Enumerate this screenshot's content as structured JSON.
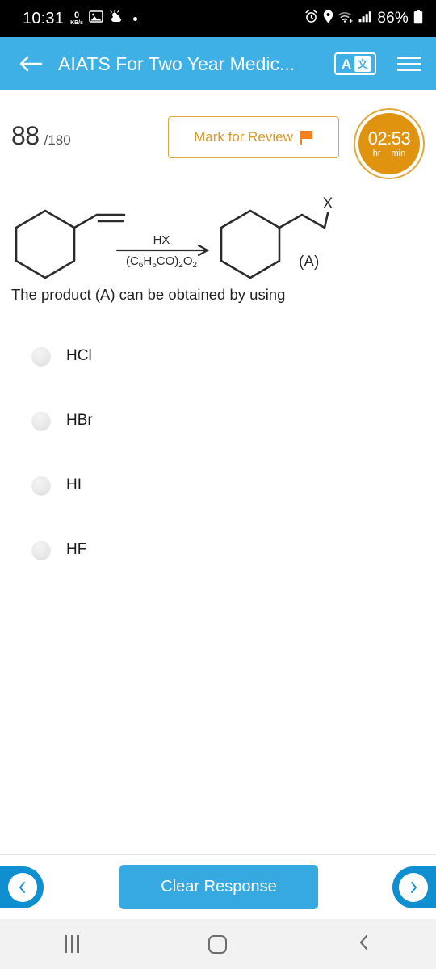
{
  "status_bar": {
    "time": "10:31",
    "data_rate_value": "0",
    "data_rate_unit": "KB/s",
    "icons": [
      "image-icon",
      "weather-icon",
      "dot-icon",
      "alarm-icon",
      "location-icon",
      "wifi-icon",
      "signal-icon",
      "battery-icon"
    ],
    "battery_percent": "86%"
  },
  "app_bar": {
    "back_label": "back-arrow",
    "title": "AIATS For Two Year Medic...",
    "translate_letter": "A",
    "translate_glyph": "文",
    "menu_label": "menu",
    "background_color": "#3fb0e5"
  },
  "question_header": {
    "current_number": "88",
    "total_label": "/180",
    "mark_for_review_label": "Mark for Review",
    "mark_for_review_color": "#d79a2b",
    "timer_value": "02:53",
    "timer_unit_hours": "hr",
    "timer_unit_minutes": "min",
    "timer_color": "#e0930f"
  },
  "question": {
    "reagent_above_arrow": "HX",
    "reagent_below_arrow": "(C6H5CO)2O2",
    "product_halogen_label": "X",
    "product_label": "(A)",
    "text": "The product (A) can be obtained by using"
  },
  "options": [
    {
      "label": "HCl",
      "selected": false
    },
    {
      "label": "HBr",
      "selected": false
    },
    {
      "label": "HI",
      "selected": false
    },
    {
      "label": "HF",
      "selected": false
    }
  ],
  "action_bar": {
    "previous_label": "previous-question",
    "next_label": "next-question",
    "clear_response_label": "Clear Response",
    "clear_button_color": "#36a9e1",
    "nav_pill_color": "#0f8fd0"
  },
  "android_nav": {
    "recents_label": "recents",
    "home_label": "home",
    "back_label": "back"
  }
}
